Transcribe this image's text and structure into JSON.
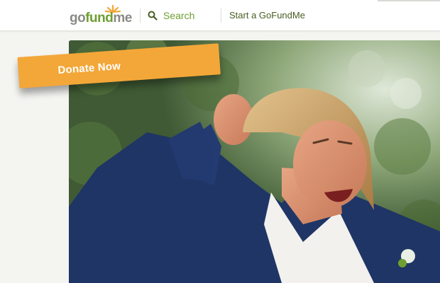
{
  "header": {
    "logo": {
      "go": "go",
      "fund": "fund",
      "me": "me",
      "icon": "sun-rays-icon"
    },
    "search": {
      "label": "Search",
      "icon": "search-icon"
    },
    "start_link": "Start a GoFundMe"
  },
  "hero": {
    "image": "campaign-photo",
    "donate_label": "Donate Now"
  },
  "colors": {
    "brand_green": "#6e9f32",
    "donate_orange": "#f3a738",
    "logo_gray": "#8a8a85",
    "link_dark_green": "#4a5d23"
  }
}
